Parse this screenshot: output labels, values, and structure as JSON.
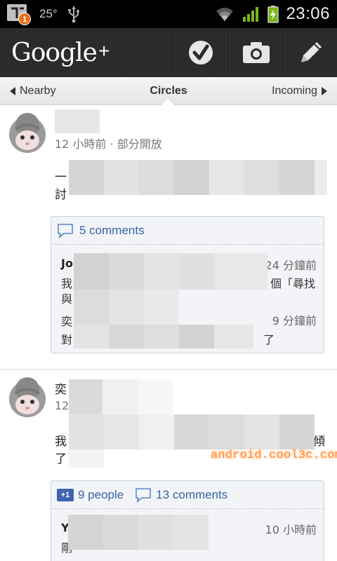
{
  "status_bar": {
    "badge_count": "1",
    "temperature": "25°",
    "time": "23:06",
    "icons": [
      "usb-icon",
      "wifi-icon",
      "signal-icon",
      "battery-charging-icon"
    ]
  },
  "action_bar": {
    "logo_word": "Google",
    "logo_plus": "+",
    "buttons": [
      "check-in-icon",
      "camera-icon",
      "compose-icon"
    ]
  },
  "tabs": {
    "left": "Nearby",
    "center": "Circles",
    "right": "Incoming"
  },
  "posts": [
    {
      "timestamp_visibility": "12 小時前 · 部分開放",
      "body_first_chars": [
        "一",
        "討"
      ],
      "comment_count_label": "5 comments",
      "comments": [
        {
          "name_prefix": "Jo",
          "time_suffix": "24 分鐘前",
          "line1_start": "我",
          "line1_end": "個「尋找",
          "line2_start": "與"
        },
        {
          "name_prefix": "奕",
          "time_suffix": "9 分鐘前",
          "line1_start": "對",
          "line1_end": "了"
        }
      ]
    },
    {
      "author_first_char": "奕",
      "timestamp_prefix": "12",
      "body_first_chars": [
        "我",
        "了"
      ],
      "body_end_char": "傾",
      "plus_count_label": "9 people",
      "comment_count_label": "13 comments",
      "comments": [
        {
          "name_prefix": "Y",
          "time_suffix": "10 小時前",
          "line1_start": "剛"
        }
      ]
    }
  ],
  "watermark": "android.cool3c.com",
  "colors": {
    "accent_link": "#3764a8",
    "action_bar": "#2b2b2b",
    "comment_box_bg": "#f2f4f7",
    "badge": "#e8701e",
    "watermark": "#ff8a3a"
  }
}
